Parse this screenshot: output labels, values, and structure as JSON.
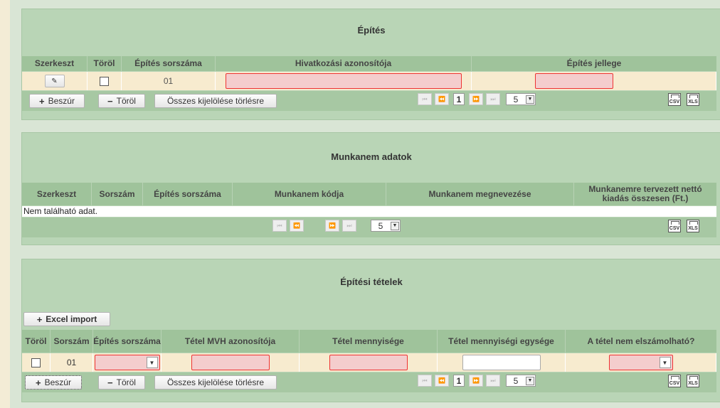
{
  "panel1": {
    "title": "Építés",
    "columns": [
      "Szerkeszt",
      "Töröl",
      "Építés sorszáma",
      "Hivatkozási azonosítója",
      "Építés jellege"
    ],
    "row": {
      "sorszam": "01"
    },
    "buttons": {
      "insert": "Beszúr",
      "delete": "Töröl",
      "clear": "Összes kijelölése törlésre"
    },
    "pager": {
      "page": "1",
      "page_size": "5"
    },
    "export": [
      "CSV",
      "XLS"
    ]
  },
  "panel2": {
    "title": "Munkanem adatok",
    "columns": [
      "Szerkeszt",
      "Sorszám",
      "Építés sorszáma",
      "Munkanem kódja",
      "Munkanem megnevezése",
      "Munkanemre tervezett nettó kiadás összesen (Ft.)"
    ],
    "empty_text": "Nem található adat.",
    "pager": {
      "page_size": "5"
    },
    "export": [
      "CSV",
      "XLS"
    ]
  },
  "panel3": {
    "title": "Építési tételek",
    "excel_import": "Excel import",
    "columns": [
      "Töröl",
      "Sorszám",
      "Építés sorszáma",
      "Tétel MVH azonosítója",
      "Tétel mennyisége",
      "Tétel mennyiségi egysége",
      "A tétel nem elszámolható?"
    ],
    "row": {
      "sorszam": "01"
    },
    "buttons": {
      "insert": "Beszúr",
      "delete": "Töröl",
      "clear": "Összes kijelölése törlésre"
    },
    "pager": {
      "page": "1",
      "page_size": "5"
    },
    "export": [
      "CSV",
      "XLS"
    ]
  },
  "icons": {
    "plus": "+",
    "minus": "−",
    "edit": "✎",
    "first": "⏮",
    "prev": "⏪",
    "next": "⏩",
    "last": "⏭",
    "dropdown": "▼"
  }
}
